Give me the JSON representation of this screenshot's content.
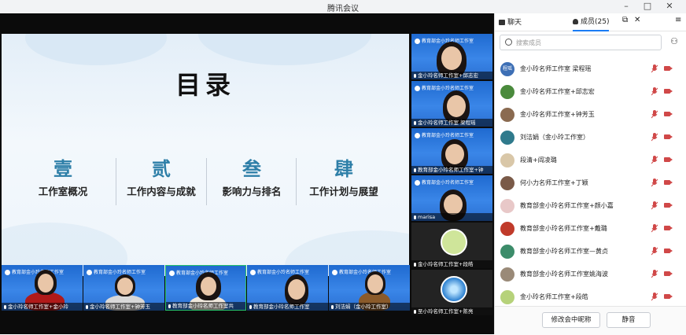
{
  "app": {
    "title": "腾讯会议"
  },
  "window_controls": {
    "minimize": "–",
    "maximize": "□",
    "close": "✕"
  },
  "slide": {
    "title": "目录",
    "sections": [
      {
        "num": "壹",
        "name": "工作室概况"
      },
      {
        "num": "贰",
        "name": "工作内容与成就"
      },
      {
        "num": "叁",
        "name": "影响力与排名"
      },
      {
        "num": "肆",
        "name": "工作计划与展望"
      }
    ]
  },
  "side_videos": [
    {
      "banner": "教育部金小玲名师工作室",
      "caption": "金小玲名师工作室+邱志宏"
    },
    {
      "banner": "教育部金小玲名师工作室",
      "caption": "金小玲名师工作室 梁程瑶"
    },
    {
      "banner": "教育部金小玲名师工作室",
      "caption": "教育部金小玲名师工作室+钟"
    },
    {
      "banner": "教育部金小玲名师工作室",
      "caption": "marisa"
    },
    {
      "banner": "",
      "caption": "金小玲名师工作室+段皓"
    },
    {
      "banner": "",
      "caption": "至小玲名师工作室+陈亮"
    }
  ],
  "bottom_videos": [
    {
      "banner": "教育部金小玲名师工作室",
      "caption": "金小玲名师工作室+金小玲"
    },
    {
      "banner": "教育部金小玲名师工作室",
      "caption": "金小玲名师工作室+钟芳玉"
    },
    {
      "banner": "教育部金小玲名师工作室",
      "caption": "教育部金小玲名师工作室共"
    },
    {
      "banner": "教育部金小玲名师工作室",
      "caption": "教育部金小玲名师工作室"
    },
    {
      "banner": "教育部金小玲名师工作室",
      "caption": "刘洁娟（金小玲工作室）"
    }
  ],
  "panel": {
    "tab_chat": "聊天",
    "tab_members": "成员(25)",
    "search_placeholder": "搜索成员",
    "members": [
      {
        "name": "金小玲名师工作室 梁程瑶",
        "avatar_text": "程瑶",
        "avatar_color": "#3d6fb5"
      },
      {
        "name": "金小玲名师工作室+邱志宏",
        "avatar_text": "",
        "avatar_color": "#4a8a3c"
      },
      {
        "name": "金小玲名师工作室+钟芳玉",
        "avatar_text": "",
        "avatar_color": "#8a6a50"
      },
      {
        "name": "刘洁娟（金小玲工作室）",
        "avatar_text": "",
        "avatar_color": "#2f7a8c"
      },
      {
        "name": "段清+阎凌璐",
        "avatar_text": "",
        "avatar_color": "#d9c7a8"
      },
      {
        "name": "何小力名师工作室+丁颖",
        "avatar_text": "",
        "avatar_color": "#7a5a48"
      },
      {
        "name": "教育部金小玲名师工作室+颜小嘉",
        "avatar_text": "",
        "avatar_color": "#e8c8c8"
      },
      {
        "name": "教育部金小玲名师工作室+戴璐",
        "avatar_text": "",
        "avatar_color": "#c03a2a"
      },
      {
        "name": "教育部金小玲名师工作室—黄贞",
        "avatar_text": "",
        "avatar_color": "#3c8c6a"
      },
      {
        "name": "教育部金小玲名师工作室姚海波",
        "avatar_text": "",
        "avatar_color": "#9a8a78"
      },
      {
        "name": "金小玲名师工作室+段皓",
        "avatar_text": "",
        "avatar_color": "#b6d27a"
      }
    ],
    "rename_button": "修改会中昵称",
    "mute_button": "静音"
  }
}
